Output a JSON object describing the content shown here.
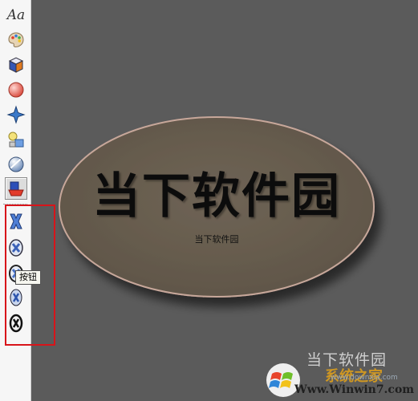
{
  "toolbar": {
    "items": [
      {
        "name": "text-style-tool",
        "label": "Aa"
      },
      {
        "name": "palette-tool",
        "icon": "palette-icon"
      },
      {
        "name": "box-tool",
        "icon": "cube-icon"
      },
      {
        "name": "sphere-tool",
        "icon": "sphere-icon"
      },
      {
        "name": "star-tool",
        "icon": "star-icon"
      },
      {
        "name": "lights-tool",
        "icon": "light-icon"
      },
      {
        "name": "orb-tool",
        "icon": "orb-icon"
      },
      {
        "name": "shape-3d-tool",
        "icon": "shape-3d-icon",
        "active": true
      }
    ],
    "x_buttons": [
      {
        "name": "x-style-1",
        "icon": "x-icon"
      },
      {
        "name": "x-style-2",
        "icon": "x-icon"
      },
      {
        "name": "x-style-3",
        "icon": "x-icon"
      },
      {
        "name": "x-style-4",
        "icon": "x-icon"
      },
      {
        "name": "x-style-5",
        "icon": "x-icon"
      }
    ],
    "tooltip": "按钮"
  },
  "canvas": {
    "oval_title": "当下软件园",
    "oval_subtitle": "当下软件园",
    "colors": {
      "background": "#5b5b5b",
      "oval_fill": "#6a5f52",
      "oval_rim": "#c8a89a"
    }
  },
  "watermark": {
    "site_name": "当下软件园",
    "xitong": "系统之家",
    "url": "Www.Winwin7.com",
    "domain": "www.downxia.com"
  }
}
